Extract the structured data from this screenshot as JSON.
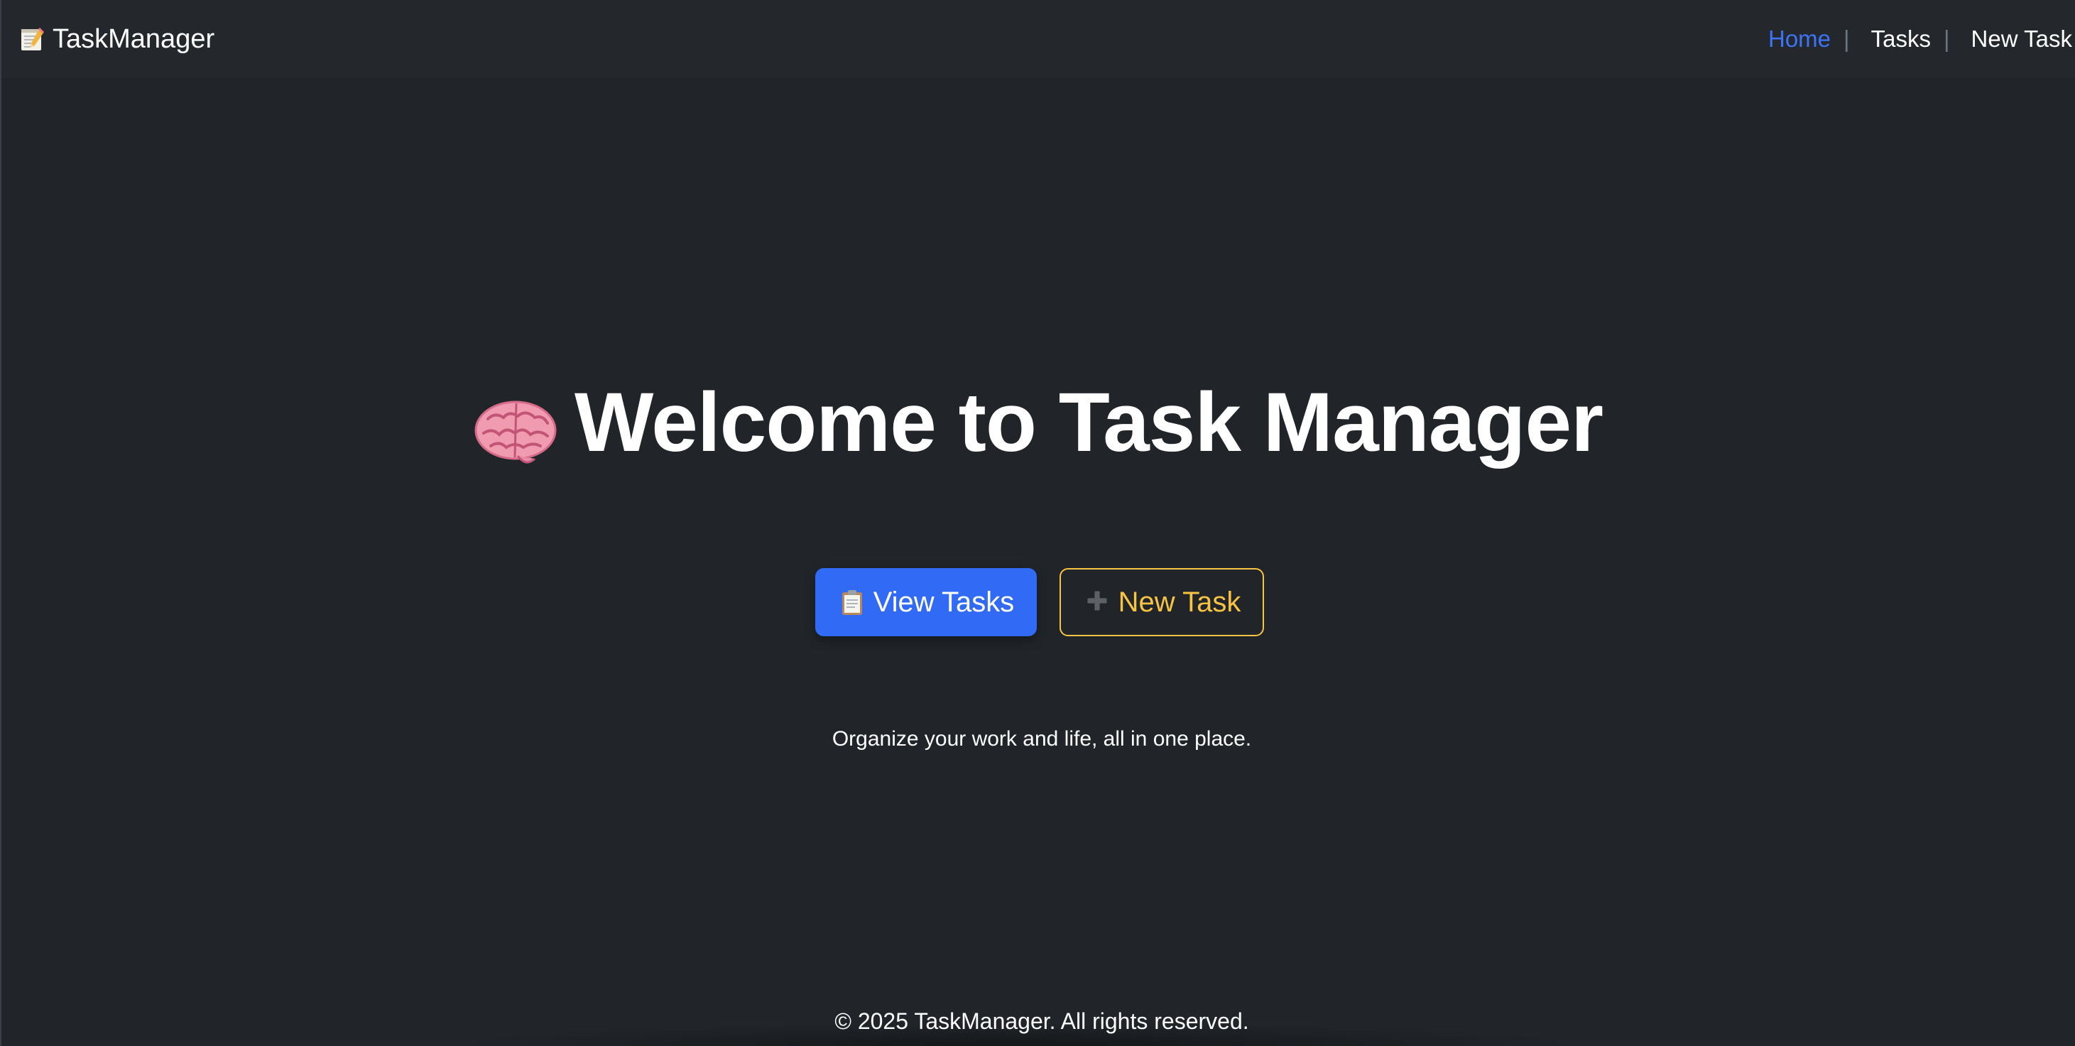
{
  "navbar": {
    "brand": {
      "icon": "memo-icon",
      "label": "TaskManager"
    },
    "links": [
      {
        "label": "Home",
        "active": true
      },
      {
        "label": "Tasks",
        "active": false
      },
      {
        "label": "New Task",
        "active": false
      }
    ],
    "separator": "|"
  },
  "hero": {
    "icon": "brain-icon",
    "title": "Welcome to Task Manager",
    "tagline": "Organize your work and life, all in one place."
  },
  "actions": {
    "view_tasks": {
      "icon": "clipboard-icon",
      "label": "View Tasks"
    },
    "new_task": {
      "icon": "plus-icon",
      "label": "New Task"
    }
  },
  "footer": {
    "text": "© 2025 TaskManager. All rights reserved."
  },
  "colors": {
    "background": "#212529",
    "navbar": "#24282d",
    "primary": "#316bf5",
    "active_link": "#3d74f5",
    "warning": "#f6c342"
  }
}
